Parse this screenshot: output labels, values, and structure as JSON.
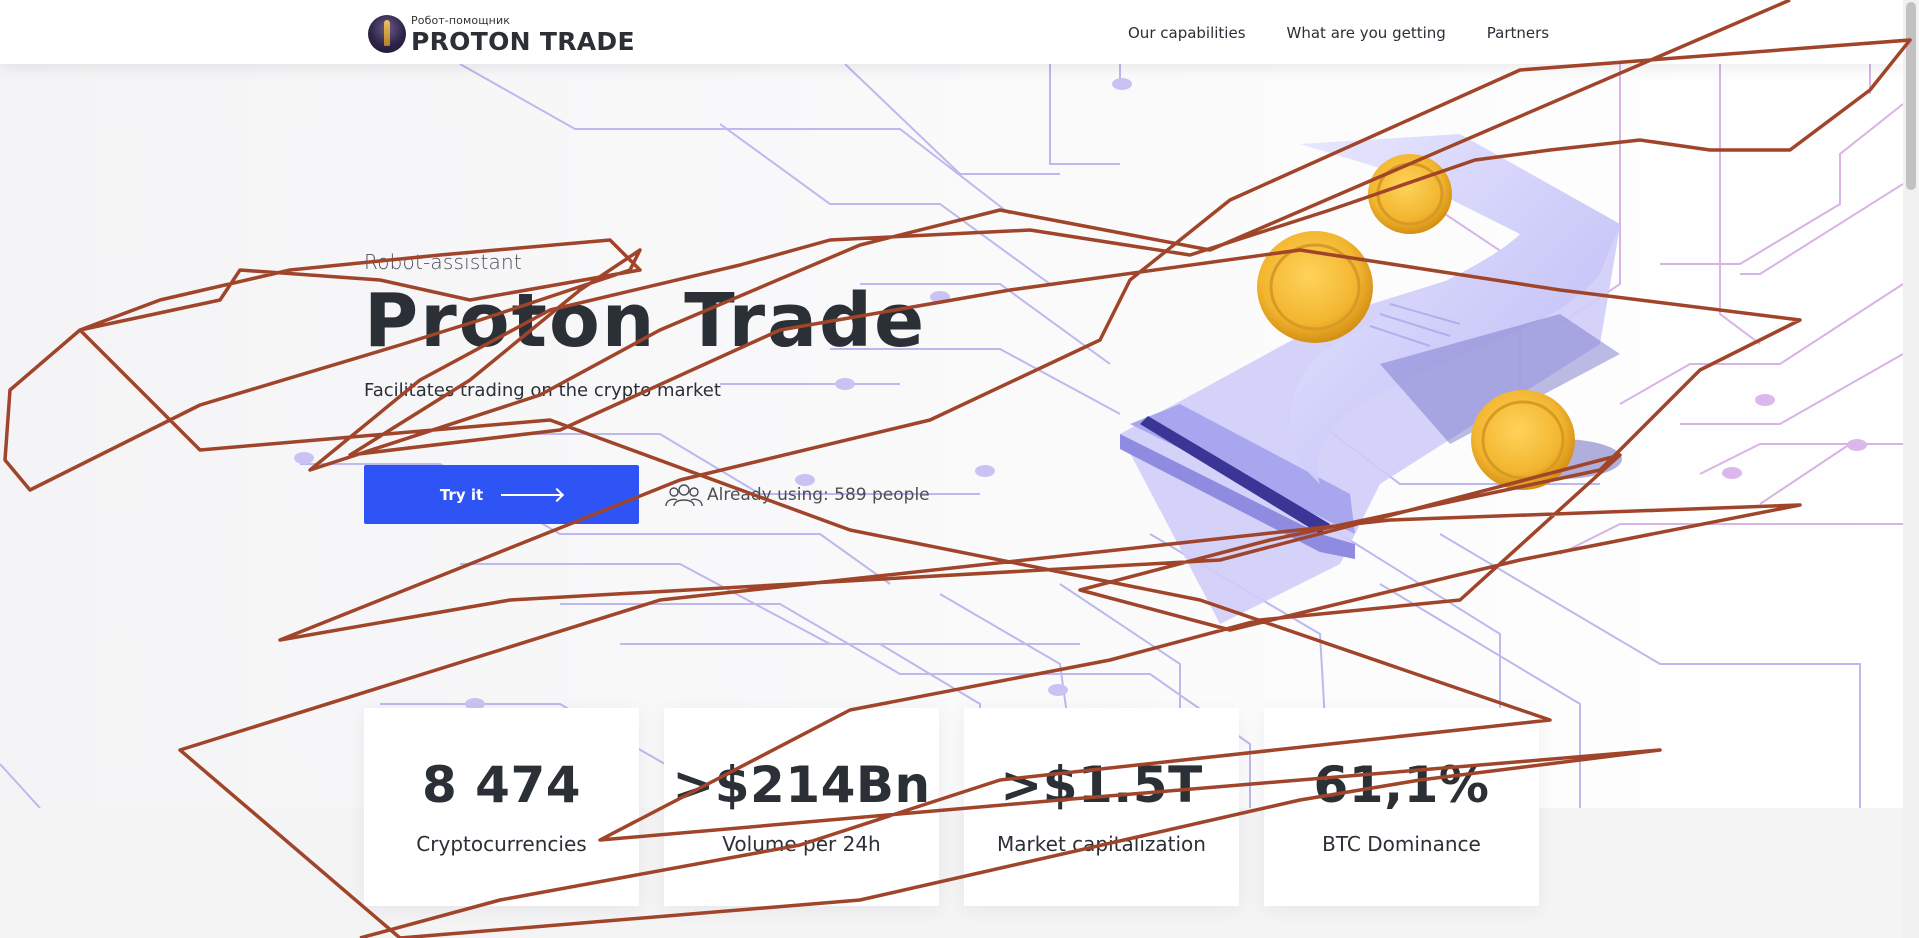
{
  "header": {
    "brand_sub": "Робот-помощник",
    "brand_name": "PROTON TRADE",
    "nav": [
      "Our capabilities",
      "What are you getting",
      "Partners"
    ]
  },
  "hero": {
    "subtitle": "Robot-assistant",
    "title": "Proton Trade",
    "description": "Facilitates trading on the crypto market",
    "cta_label": "Try it",
    "users_text": "Already using: 589 people"
  },
  "stats": [
    {
      "value": "8 474",
      "label": "Cryptocurrencies"
    },
    {
      "value": ">$214Bn",
      "label": "Volume per 24h"
    },
    {
      "value": ">$1.5T",
      "label": "Market capitalization"
    },
    {
      "value": "61,1%",
      "label": "BTC Dominance"
    }
  ],
  "colors": {
    "accent": "#2f54f5",
    "text": "#2b2f36",
    "circuit": "#b8b3ea",
    "coin": "#f2b630",
    "scribble": "#a0442a"
  },
  "icons": [
    "users-icon",
    "arrow-right-icon",
    "logo-icon"
  ]
}
